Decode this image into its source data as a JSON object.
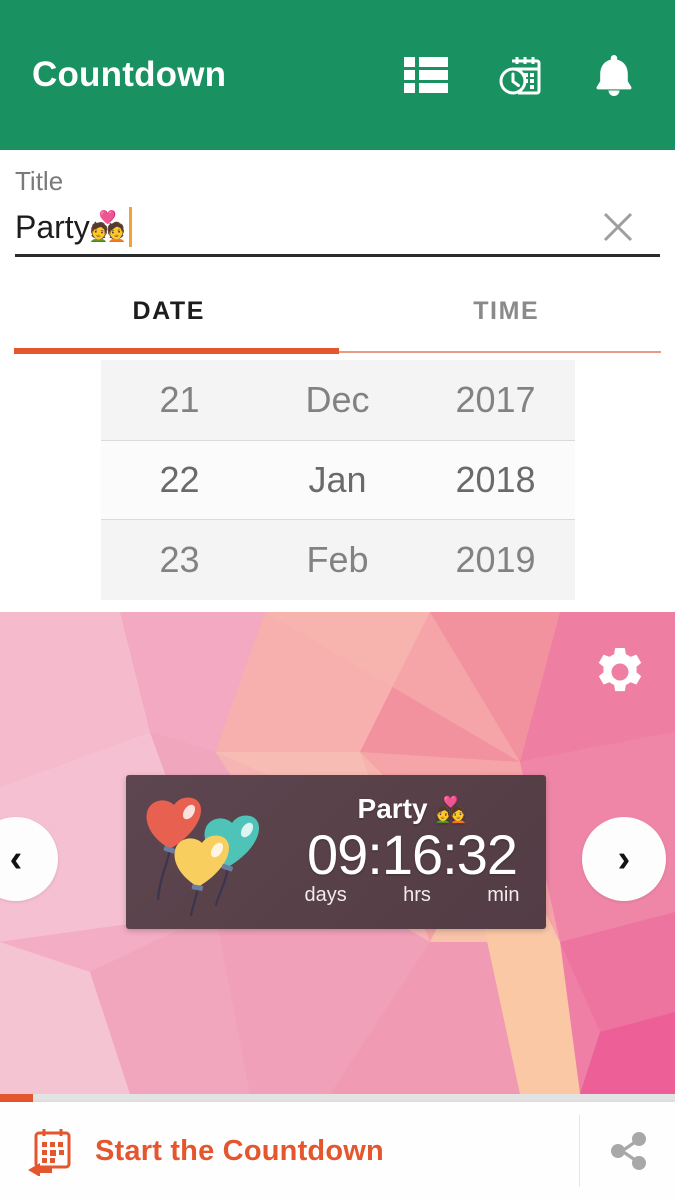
{
  "appbar": {
    "title": "Countdown",
    "actions": [
      {
        "name": "list-view-icon",
        "label": "List view"
      },
      {
        "name": "calendar-clock-icon",
        "label": "Scheduled events"
      },
      {
        "name": "bell-icon",
        "label": "Notifications"
      }
    ]
  },
  "title_field": {
    "label": "Title",
    "value": "Party ",
    "emoji": "💑",
    "placeholder": "Title",
    "clear_icon": "close-icon"
  },
  "tabs": [
    {
      "label": "DATE",
      "active": true
    },
    {
      "label": "TIME",
      "active": false
    }
  ],
  "picker": {
    "day": {
      "above": "21",
      "selected": "22",
      "below": "23"
    },
    "month": {
      "above": "Dec",
      "selected": "Jan",
      "below": "Feb"
    },
    "year": {
      "above": "2017",
      "selected": "2018",
      "below": "2019"
    }
  },
  "preview": {
    "gear_icon": "gear-icon",
    "prev_label": "‹",
    "next_label": "›",
    "widget": {
      "title": "Party ",
      "emoji": "💑",
      "time": "09:16:32",
      "units": [
        "days",
        "hrs",
        "min"
      ],
      "background_color": "#584048"
    }
  },
  "bottom_bar": {
    "start_label": "Start the Countdown",
    "start_icon": "calendar-back-icon",
    "share_icon": "share-icon",
    "progress_percent": 5
  },
  "colors": {
    "brand_green": "#1a9160",
    "accent_orange": "#e4572e",
    "widget_bg": "#584048",
    "balloon_red": "#e8604f",
    "balloon_teal": "#4ec3b8",
    "balloon_yellow": "#f8ce5e"
  }
}
